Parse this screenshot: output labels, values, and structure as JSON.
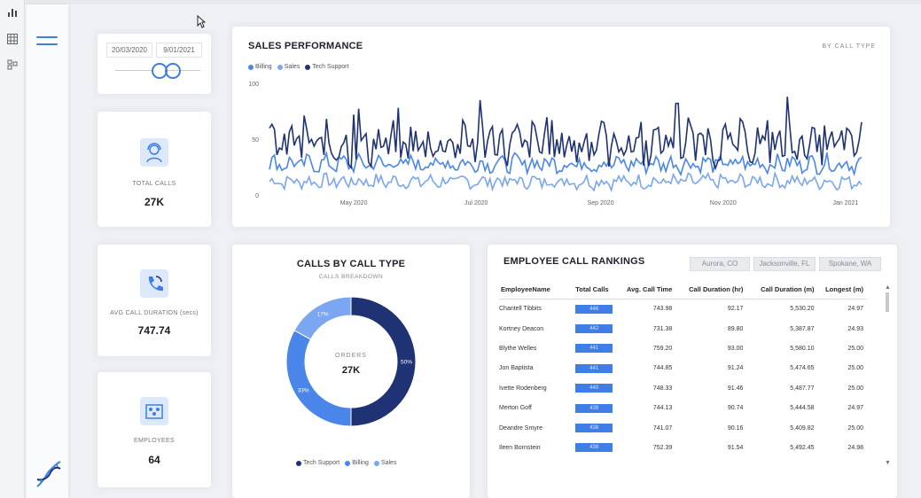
{
  "filters": {
    "start_date": "20/03/2020",
    "end_date": "9/01/2021"
  },
  "kpis": {
    "total_calls": {
      "label": "TOTAL CALLS",
      "value": "27K"
    },
    "avg_call_duration": {
      "label": "AVG CALL DURATION (secs)",
      "value": "747.74"
    },
    "employees": {
      "label": "EMPLOYEES",
      "value": "64"
    }
  },
  "sales_performance": {
    "title": "SALES PERFORMANCE",
    "toggle": "BY CALL TYPE",
    "legend": [
      "Billing",
      "Sales",
      "Tech Support"
    ]
  },
  "calls_by_type": {
    "title": "CALLS BY CALL TYPE",
    "subtitle": "CALLS BREAKDOWN",
    "center_label": "ORDERS",
    "center_value": "27K",
    "legend": [
      "Tech Support",
      "Billing",
      "Sales"
    ]
  },
  "rankings": {
    "title": "EMPLOYEE CALL RANKINGS",
    "city_filters": [
      "Aurora, CO",
      "Jacksonville, FL",
      "Spokane, WA"
    ],
    "columns": [
      "EmployeeName",
      "Total Calls",
      "Avg. Call Time",
      "Call Duration (hr)",
      "Call Duration (m)",
      "Longest (m)"
    ],
    "rows": [
      {
        "name": "Chantell Tibbits",
        "calls": "446",
        "avg": "743.98",
        "hr": "92.17",
        "m": "5,530.20",
        "longest": "24.97"
      },
      {
        "name": "Kortney Deacon",
        "calls": "442",
        "avg": "731.38",
        "hr": "89.80",
        "m": "5,387.87",
        "longest": "24.93"
      },
      {
        "name": "Blythe Welles",
        "calls": "441",
        "avg": "759.20",
        "hr": "93.00",
        "m": "5,580.10",
        "longest": "25.00"
      },
      {
        "name": "Jon Baptista",
        "calls": "441",
        "avg": "744.85",
        "hr": "91.24",
        "m": "5,474.65",
        "longest": "25.00"
      },
      {
        "name": "Ivette Rodenberg",
        "calls": "440",
        "avg": "748.33",
        "hr": "91.46",
        "m": "5,487.77",
        "longest": "25.00"
      },
      {
        "name": "Merton Goff",
        "calls": "439",
        "avg": "744.13",
        "hr": "90.74",
        "m": "5,444.58",
        "longest": "24.97"
      },
      {
        "name": "Deandre Smyre",
        "calls": "438",
        "avg": "741.07",
        "hr": "90.16",
        "m": "5,409.82",
        "longest": "25.00"
      },
      {
        "name": "Ileen Bornstein",
        "calls": "438",
        "avg": "752.39",
        "hr": "91.54",
        "m": "5,492.45",
        "longest": "24.98"
      }
    ]
  },
  "colors": {
    "billing": "#4a86ea",
    "sales": "#7aa6f2",
    "tech_support": "#1f3273",
    "accent": "#3f7ee6"
  },
  "chart_data": [
    {
      "type": "line",
      "title": "SALES PERFORMANCE",
      "xlabel": "",
      "ylabel": "",
      "ylim": [
        0,
        100
      ],
      "yticks": [
        0,
        50,
        100
      ],
      "xticks": [
        "May 2020",
        "Jul 2020",
        "Sep 2020",
        "Nov 2020",
        "Jan 2021"
      ],
      "x_range": [
        "2020-03-20",
        "2021-01-09"
      ],
      "legend_position": "top-left",
      "grid": false,
      "series": [
        {
          "name": "Billing",
          "approx_mean": 28,
          "approx_range": [
            15,
            40
          ]
        },
        {
          "name": "Sales",
          "approx_mean": 12,
          "approx_range": [
            5,
            25
          ]
        },
        {
          "name": "Tech Support",
          "approx_mean": 45,
          "approx_range": [
            30,
            90
          ],
          "peaks": [
            {
              "x": "2020-05-01",
              "y": 72
            },
            {
              "x": "2020-07-03",
              "y": 85
            },
            {
              "x": "2020-10-09",
              "y": 82
            },
            {
              "x": "2020-12-03",
              "y": 88
            }
          ]
        }
      ]
    },
    {
      "type": "pie",
      "title": "CALLS BY CALL TYPE",
      "donut": true,
      "labels": [
        "Tech Support",
        "Billing",
        "Sales"
      ],
      "values": [
        50,
        33,
        17
      ],
      "value_labels": [
        "50%",
        "33%",
        "17%"
      ]
    }
  ]
}
